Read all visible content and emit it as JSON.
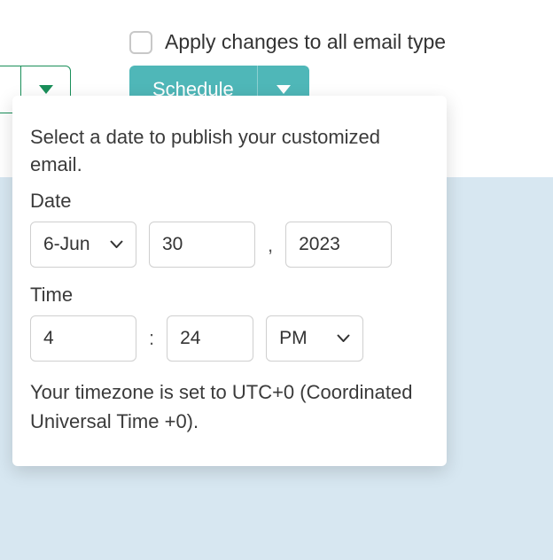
{
  "checkbox": {
    "label": "Apply changes to all email type"
  },
  "schedule_button": {
    "label": "Schedule"
  },
  "popover": {
    "intro": "Select a date to publish your customized email.",
    "date_label": "Date",
    "time_label": "Time",
    "month": "6-Jun",
    "day": "30",
    "year": "2023",
    "hour": "4",
    "minute": "24",
    "ampm": "PM",
    "timezone_note": "Your timezone is set to UTC+0 (Coordinated Universal Time +0)."
  }
}
